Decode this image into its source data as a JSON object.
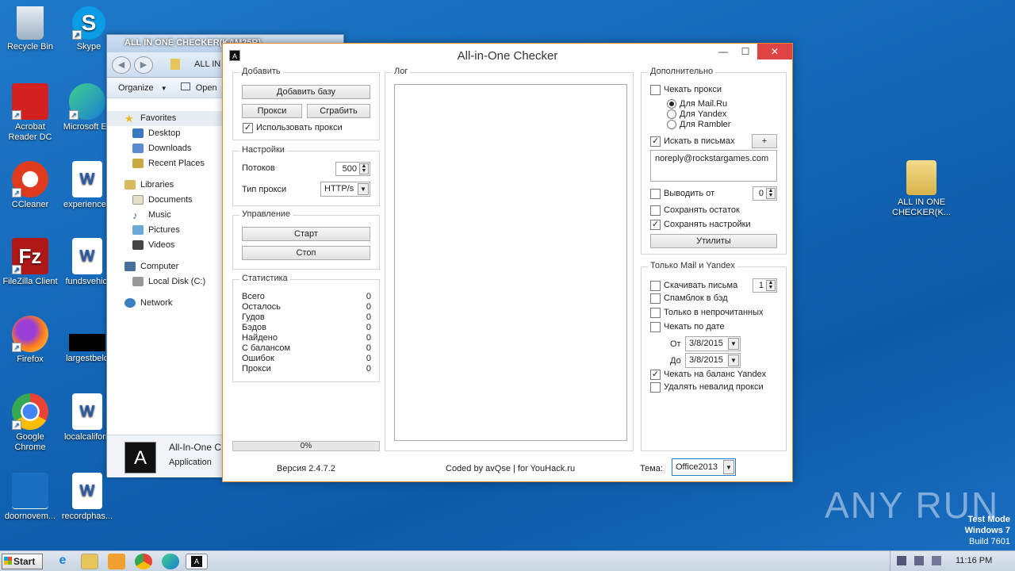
{
  "desktop": {
    "icons": [
      {
        "label": "Recycle Bin"
      },
      {
        "label": "Skype"
      },
      {
        "label": "Acrobat Reader DC"
      },
      {
        "label": "Microsoft Ec"
      },
      {
        "label": "CCleaner"
      },
      {
        "label": "experienceа"
      },
      {
        "label": "FileZilla Client"
      },
      {
        "label": "fundsvehicl"
      },
      {
        "label": "Firefox"
      },
      {
        "label": "largestbelo"
      },
      {
        "label": "Google Chrome"
      },
      {
        "label": "localcaliforn"
      },
      {
        "label": "doornovem..."
      },
      {
        "label": "recordphas..."
      },
      {
        "label": "ALL IN ONE CHECKER(K..."
      }
    ],
    "watermark": "ANY RUN",
    "test_mode": {
      "line1": "Test Mode",
      "line2": "Windows 7",
      "line3": "Build 7601"
    }
  },
  "explorer": {
    "title": "ALL IN ONE CHECKER(KAM25R)",
    "address_text": "ALL IN",
    "toolbar": {
      "organize": "Organize",
      "open": "Open"
    },
    "nav": {
      "favorites": "Favorites",
      "desktop": "Desktop",
      "downloads": "Downloads",
      "recent": "Recent Places",
      "libraries": "Libraries",
      "documents": "Documents",
      "music": "Music",
      "pictures": "Pictures",
      "videos": "Videos",
      "computer": "Computer",
      "local_disk": "Local Disk (C:)",
      "network": "Network"
    },
    "details": {
      "name": "All-In-One C",
      "type": "Application"
    }
  },
  "app": {
    "title": "All-in-One Checker",
    "logo_letter": "A",
    "add": {
      "legend": "Добавить",
      "add_base": "Добавить базу",
      "proxy": "Прокси",
      "grab": "Сграбить",
      "use_proxy": "Использовать прокси"
    },
    "settings": {
      "legend": "Настройки",
      "threads_label": "Потоков",
      "threads_value": "500",
      "proxy_type_label": "Тип прокси",
      "proxy_type_value": "HTTP/s"
    },
    "control": {
      "legend": "Управление",
      "start": "Старт",
      "stop": "Стоп"
    },
    "stats": {
      "legend": "Статистика",
      "rows": [
        {
          "label": "Всего",
          "value": "0"
        },
        {
          "label": "Осталось",
          "value": "0"
        },
        {
          "label": "Гудов",
          "value": "0"
        },
        {
          "label": "Бэдов",
          "value": "0"
        },
        {
          "label": "Найдено",
          "value": "0"
        },
        {
          "label": "С балансом",
          "value": "0"
        },
        {
          "label": "Ошибок",
          "value": "0"
        },
        {
          "label": "Прокси",
          "value": "0"
        }
      ]
    },
    "progress": {
      "text": "0%",
      "fraction": 0
    },
    "log": {
      "legend": "Лог"
    },
    "extra": {
      "legend": "Дополнительно",
      "check_proxy": "Чекать прокси",
      "for_mailru": "Для Mail.Ru",
      "for_yandex": "Для Yandex",
      "for_rambler": "Для Rambler",
      "search_in_mail": "Искать в письмах",
      "plus": "+",
      "search_text": "noreply@rockstargames.com",
      "output_from": "Выводить от",
      "output_from_value": "0",
      "save_rest": "Сохранять остаток",
      "save_settings": "Сохранять настройки",
      "utilities": "Утилиты"
    },
    "mail_yandex": {
      "legend": "Только Mail и Yandex",
      "download_mails": "Скачивать письма",
      "download_value": "1",
      "spamblock": "Спамблок в бэд",
      "unread_only": "Только в непрочитанных",
      "check_by_date": "Чекать по дате",
      "from_label": "От",
      "from_value": "3/8/2015",
      "to_label": "До",
      "to_value": "3/8/2015",
      "check_balance": "Чекать на баланс Yandex",
      "delete_invalid_proxy": "Удалять невалид прокси"
    },
    "footer": {
      "version": "Версия 2.4.7.2",
      "credits": "Coded by avQse | for YouHack.ru",
      "theme_label": "Тема:",
      "theme_value": "Office2013"
    }
  },
  "taskbar": {
    "start": "Start",
    "time": "11:16 PM"
  },
  "colors": {
    "accent": "#e28b2a",
    "desktop": "#1467b8",
    "close": "#e04343"
  }
}
